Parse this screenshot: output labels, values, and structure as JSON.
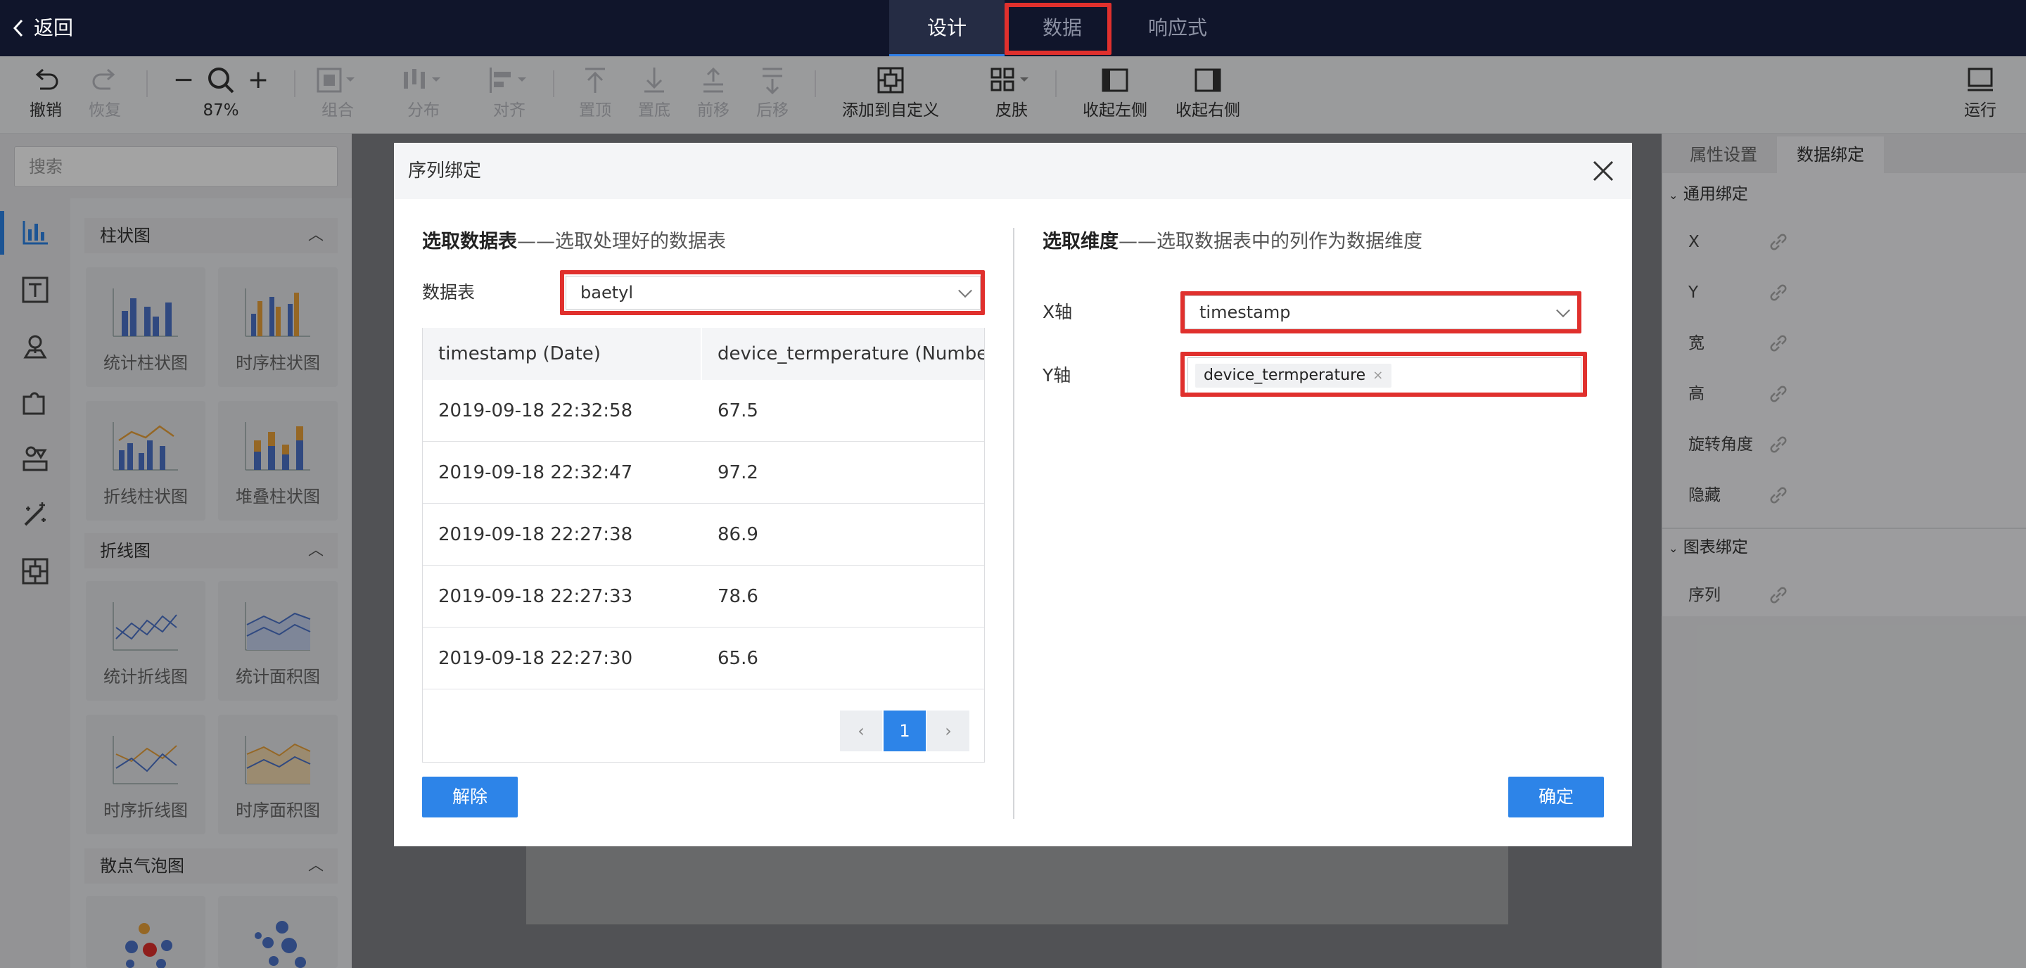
{
  "topbar": {
    "back_label": "返回",
    "tabs": [
      {
        "label": "设计",
        "active": true
      },
      {
        "label": "数据",
        "active": false,
        "highlighted": true
      },
      {
        "label": "响应式",
        "active": false
      }
    ]
  },
  "toolbar": {
    "undo": "撤销",
    "redo": "恢复",
    "zoom": "87%",
    "group": "组合",
    "distribute": "分布",
    "align": "对齐",
    "to_top": "置顶",
    "to_bottom": "置底",
    "forward": "前移",
    "backward": "后移",
    "add_custom": "添加到自定义",
    "skin": "皮肤",
    "collapse_left": "收起左侧",
    "collapse_right": "收起右侧",
    "run": "运行"
  },
  "left_panel": {
    "search_placeholder": "搜索",
    "sections": [
      {
        "title": "柱状图",
        "items": [
          "统计柱状图",
          "时序柱状图",
          "折线柱状图",
          "堆叠柱状图"
        ]
      },
      {
        "title": "折线图",
        "items": [
          "统计折线图",
          "统计面积图",
          "时序折线图",
          "时序面积图"
        ]
      },
      {
        "title": "散点气泡图",
        "items": [
          "",
          ""
        ]
      }
    ]
  },
  "right_panel": {
    "tabs": [
      "属性设置",
      "数据绑定"
    ],
    "active_tab": "数据绑定",
    "general_title": "通用绑定",
    "general_items": [
      "X",
      "Y",
      "宽",
      "高",
      "旋转角度",
      "隐藏"
    ],
    "chart_title": "图表绑定",
    "chart_items": [
      "序列"
    ]
  },
  "modal": {
    "title": "序列绑定",
    "left": {
      "heading_bold": "选取数据表",
      "heading_rest": "——选取处理好的数据表",
      "table_label": "数据表",
      "table_value": "baetyl",
      "columns": [
        "timestamp (Date)",
        "device_termperature (Number)"
      ],
      "rows": [
        [
          "2019-09-18 22:32:58",
          "67.5"
        ],
        [
          "2019-09-18 22:32:47",
          "97.2"
        ],
        [
          "2019-09-18 22:27:38",
          "86.9"
        ],
        [
          "2019-09-18 22:27:33",
          "78.6"
        ],
        [
          "2019-09-18 22:27:30",
          "65.6"
        ]
      ],
      "pagination": {
        "prev": "‹",
        "current": "1",
        "next": "›"
      },
      "unbind_button": "解除"
    },
    "right": {
      "heading_bold": "选取维度",
      "heading_rest": "——选取数据表中的列作为数据维度",
      "x_label": "X轴",
      "x_value": "timestamp",
      "y_label": "Y轴",
      "y_tag": "device_termperature",
      "confirm_button": "确定"
    }
  },
  "colors": {
    "topbar": "#10152b",
    "accent": "#2d84e8",
    "highlight": "#e0302d"
  }
}
